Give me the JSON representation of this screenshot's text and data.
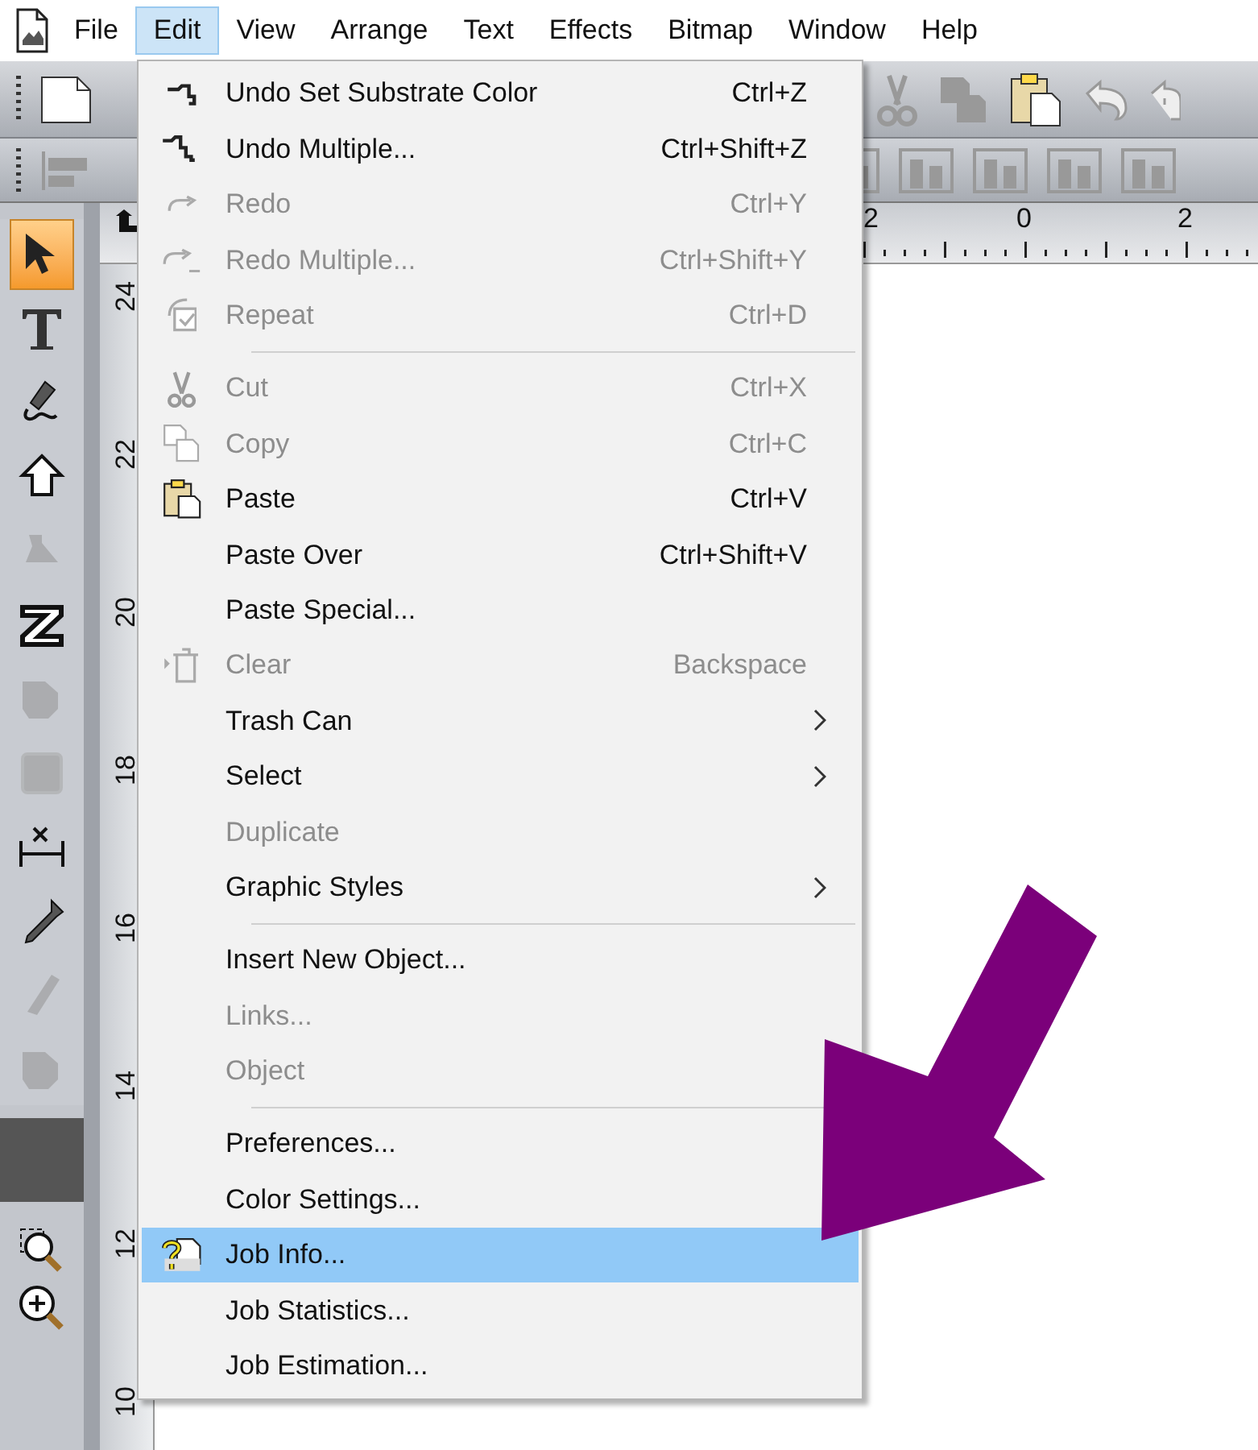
{
  "menu_bar": [
    {
      "label": "File",
      "selected": false
    },
    {
      "label": "Edit",
      "selected": true
    },
    {
      "label": "View",
      "selected": false
    },
    {
      "label": "Arrange",
      "selected": false
    },
    {
      "label": "Text",
      "selected": false
    },
    {
      "label": "Effects",
      "selected": false
    },
    {
      "label": "Bitmap",
      "selected": false
    },
    {
      "label": "Window",
      "selected": false
    },
    {
      "label": "Help",
      "selected": false
    }
  ],
  "tools": [
    {
      "kind": "pointer",
      "selected": true,
      "disabled": false
    },
    {
      "kind": "text",
      "selected": false,
      "disabled": false
    },
    {
      "kind": "pen",
      "selected": false,
      "disabled": false
    },
    {
      "kind": "arrow",
      "selected": false,
      "disabled": false
    },
    {
      "kind": "fill",
      "selected": false,
      "disabled": true
    },
    {
      "kind": "zigzag",
      "selected": false,
      "disabled": false
    },
    {
      "kind": "blob",
      "selected": false,
      "disabled": true
    },
    {
      "kind": "square",
      "selected": false,
      "disabled": true
    },
    {
      "kind": "dimension",
      "selected": false,
      "disabled": false
    },
    {
      "kind": "dropper",
      "selected": false,
      "disabled": false
    },
    {
      "kind": "knife",
      "selected": false,
      "disabled": true
    },
    {
      "kind": "blob",
      "selected": false,
      "disabled": true
    }
  ],
  "zoom_tools": [
    {
      "kind": "zoom-area"
    },
    {
      "kind": "zoom-in"
    }
  ],
  "horizontal_ruler": [
    "2",
    "0",
    "2"
  ],
  "vertical_ruler": [
    "24",
    "22",
    "20",
    "18",
    "16",
    "14",
    "12",
    "10"
  ],
  "edit_menu": [
    {
      "kind": "item",
      "label": "Undo Set Substrate Color",
      "shortcut": "Ctrl+Z",
      "disabled": false,
      "submenu": false,
      "selected": false
    },
    {
      "kind": "item",
      "label": "Undo Multiple...",
      "shortcut": "Ctrl+Shift+Z",
      "disabled": false,
      "submenu": false,
      "selected": false
    },
    {
      "kind": "item",
      "label": "Redo",
      "shortcut": "Ctrl+Y",
      "disabled": true,
      "submenu": false,
      "selected": false
    },
    {
      "kind": "item",
      "label": "Redo Multiple...",
      "shortcut": "Ctrl+Shift+Y",
      "disabled": true,
      "submenu": false,
      "selected": false
    },
    {
      "kind": "item",
      "label": "Repeat",
      "shortcut": "Ctrl+D",
      "disabled": true,
      "submenu": false,
      "selected": false
    },
    {
      "kind": "separator"
    },
    {
      "kind": "item",
      "label": "Cut",
      "shortcut": "Ctrl+X",
      "disabled": true,
      "submenu": false,
      "selected": false
    },
    {
      "kind": "item",
      "label": "Copy",
      "shortcut": "Ctrl+C",
      "disabled": true,
      "submenu": false,
      "selected": false
    },
    {
      "kind": "item",
      "label": "Paste",
      "shortcut": "Ctrl+V",
      "disabled": false,
      "submenu": false,
      "selected": false
    },
    {
      "kind": "item",
      "label": "Paste Over",
      "shortcut": "Ctrl+Shift+V",
      "disabled": false,
      "submenu": false,
      "selected": false
    },
    {
      "kind": "item",
      "label": "Paste Special...",
      "disabled": false,
      "submenu": false,
      "selected": false
    },
    {
      "kind": "item",
      "label": "Clear",
      "shortcut": "Backspace",
      "disabled": true,
      "submenu": false,
      "selected": false
    },
    {
      "kind": "item",
      "label": "Trash Can",
      "disabled": false,
      "submenu": true,
      "selected": false
    },
    {
      "kind": "item",
      "label": "Select",
      "disabled": false,
      "submenu": true,
      "selected": false
    },
    {
      "kind": "item",
      "label": "Duplicate",
      "disabled": true,
      "submenu": false,
      "selected": false
    },
    {
      "kind": "item",
      "label": "Graphic Styles",
      "disabled": false,
      "submenu": true,
      "selected": false
    },
    {
      "kind": "separator"
    },
    {
      "kind": "item",
      "label": "Insert New Object...",
      "disabled": false,
      "submenu": false,
      "selected": false
    },
    {
      "kind": "item",
      "label": "Links...",
      "disabled": true,
      "submenu": false,
      "selected": false
    },
    {
      "kind": "item",
      "label": "Object",
      "disabled": true,
      "submenu": false,
      "selected": false
    },
    {
      "kind": "separator"
    },
    {
      "kind": "item",
      "label": "Preferences...",
      "disabled": false,
      "submenu": false,
      "selected": false
    },
    {
      "kind": "item",
      "label": "Color Settings...",
      "disabled": false,
      "submenu": false,
      "selected": false
    },
    {
      "kind": "item",
      "label": "Job Info...",
      "disabled": false,
      "submenu": false,
      "selected": true
    },
    {
      "kind": "item",
      "label": "Job Statistics...",
      "disabled": false,
      "submenu": false,
      "selected": false
    },
    {
      "kind": "item",
      "label": "Job Estimation...",
      "disabled": false,
      "submenu": false,
      "selected": false
    }
  ]
}
